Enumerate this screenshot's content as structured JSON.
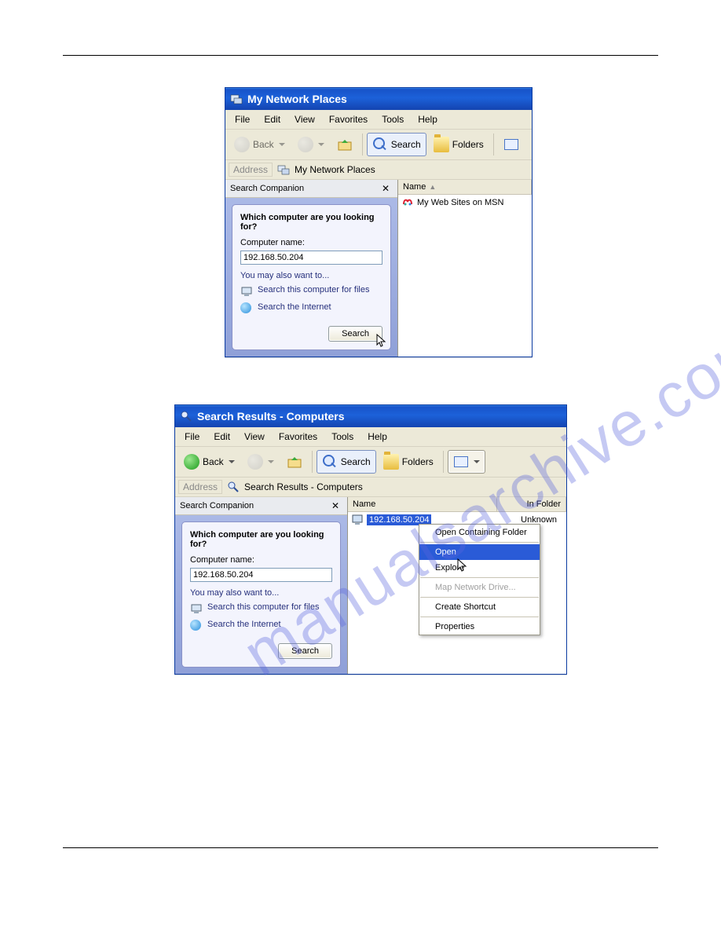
{
  "watermark_text": "manualsarchive.com",
  "window1": {
    "title": "My Network Places",
    "menu": [
      "File",
      "Edit",
      "View",
      "Favorites",
      "Tools",
      "Help"
    ],
    "toolbar": {
      "back": "Back",
      "search": "Search",
      "folders": "Folders"
    },
    "address": {
      "label": "Address",
      "value": "My Network Places"
    },
    "search": {
      "pane_title": "Search Companion",
      "question": "Which computer are you looking for?",
      "field_label": "Computer name:",
      "field_value": "192.168.50.204",
      "hint": "You may also want to...",
      "opt1": "Search this computer for files",
      "opt2": "Search the Internet",
      "button": "Search"
    },
    "list": {
      "col_name": "Name",
      "item1": "My Web Sites on MSN"
    }
  },
  "window2": {
    "title": "Search Results - Computers",
    "menu": [
      "File",
      "Edit",
      "View",
      "Favorites",
      "Tools",
      "Help"
    ],
    "toolbar": {
      "back": "Back",
      "search": "Search",
      "folders": "Folders"
    },
    "address": {
      "label": "Address",
      "value": "Search Results - Computers"
    },
    "search": {
      "pane_title": "Search Companion",
      "question": "Which computer are you looking for?",
      "field_label": "Computer name:",
      "field_value": "192.168.50.204",
      "hint": "You may also want to...",
      "opt1": "Search this computer for files",
      "opt2": "Search the Internet",
      "button": "Search"
    },
    "list": {
      "col_name": "Name",
      "col_folder": "In Folder",
      "row_name": "192.168.50.204",
      "row_folder": "Unknown"
    },
    "ctx": {
      "open_containing": "Open Containing Folder",
      "open": "Open",
      "explore": "Explore",
      "map": "Map Network Drive...",
      "shortcut": "Create Shortcut",
      "properties": "Properties"
    }
  }
}
